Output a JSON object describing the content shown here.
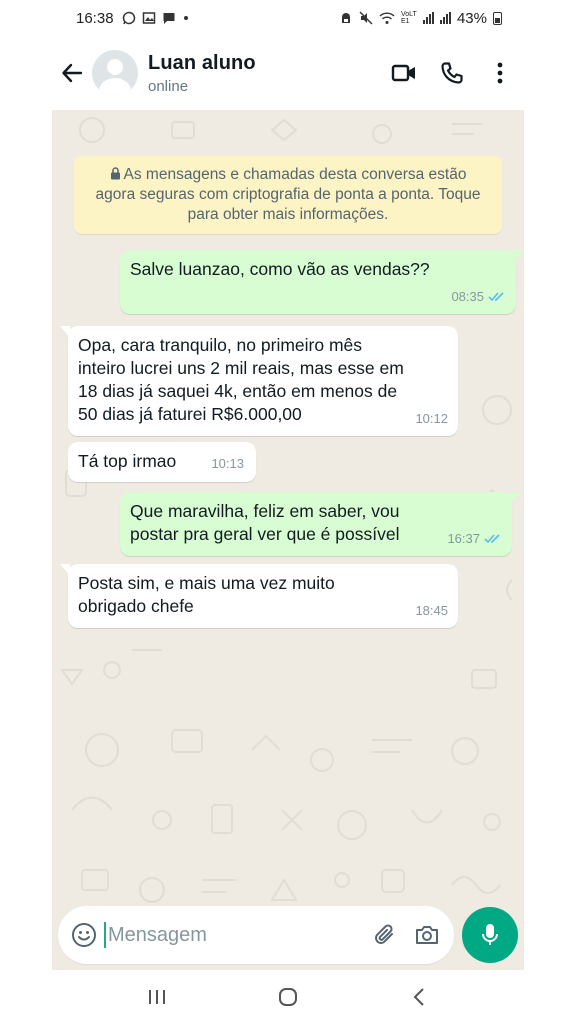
{
  "status_bar": {
    "time": "16:38",
    "network_label": "VoLTE1",
    "battery": "43%"
  },
  "header": {
    "contact_name": "Luan aluno",
    "contact_status": "online"
  },
  "encryption_notice": "As mensagens e chamadas desta conversa estão agora seguras com criptografia de ponta a ponta. Toque para obter mais informações.",
  "messages": [
    {
      "direction": "out",
      "text": "Salve luanzao, como vão as vendas??",
      "time": "08:35",
      "read": true
    },
    {
      "direction": "in",
      "text": "Opa, cara tranquilo, no primeiro mês inteiro lucrei uns 2 mil reais, mas esse em 18 dias já saquei 4k, então em menos de 50 dias já faturei R$6.000,00",
      "time": "10:12"
    },
    {
      "direction": "in",
      "text": "Tá top irmao",
      "time": "10:13"
    },
    {
      "direction": "out",
      "text": "Que maravilha, feliz em saber, vou postar pra geral ver que é possível",
      "time": "16:37",
      "read": true
    },
    {
      "direction": "in",
      "text": "Posta sim, e mais uma vez muito obrigado chefe",
      "time": "18:45"
    }
  ],
  "composer": {
    "placeholder": "Mensagem"
  },
  "colors": {
    "accent": "#00a884",
    "outgoing_bubble": "#d9fdd3",
    "incoming_bubble": "#ffffff",
    "chat_background": "#efeae2",
    "notice_background": "#fdf4c5",
    "read_ticks": "#53bdeb"
  },
  "icons": {
    "back": "arrow-left-icon",
    "video": "video-camera-icon",
    "call": "phone-icon",
    "menu": "more-vertical-icon",
    "emoji": "emoji-icon",
    "attach": "paperclip-icon",
    "camera": "camera-icon",
    "mic": "microphone-icon"
  }
}
